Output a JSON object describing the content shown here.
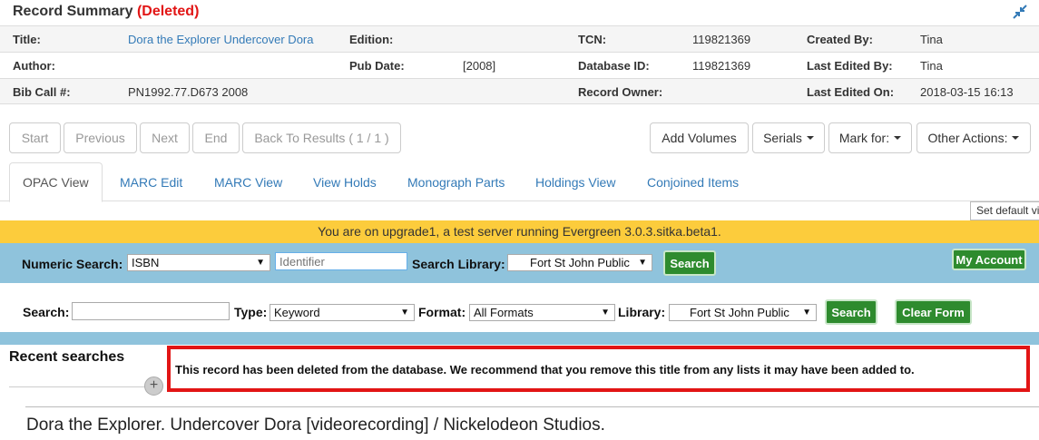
{
  "header": {
    "title": "Record Summary",
    "status": "(Deleted)"
  },
  "summary": {
    "title_label": "Title:",
    "title_value": "Dora the Explorer Undercover Dora",
    "edition_label": "Edition:",
    "edition_value": "",
    "tcn_label": "TCN:",
    "tcn_value": "119821369",
    "created_by_label": "Created By:",
    "created_by_value": "Tina",
    "author_label": "Author:",
    "author_value": "",
    "pub_date_label": "Pub Date:",
    "pub_date_value": "[2008]",
    "db_id_label": "Database ID:",
    "db_id_value": "119821369",
    "last_edited_by_label": "Last Edited By:",
    "last_edited_by_value": "Tina",
    "bib_call_label": "Bib Call #:",
    "bib_call_value": "PN1992.77.D673 2008",
    "owner_label": "Record Owner:",
    "owner_value": "",
    "last_edited_on_label": "Last Edited On:",
    "last_edited_on_value": "2018-03-15 16:13"
  },
  "nav": {
    "start": "Start",
    "previous": "Previous",
    "next": "Next",
    "end": "End",
    "back": "Back To Results ( 1 / 1 )"
  },
  "actions": {
    "add_volumes": "Add Volumes",
    "serials": "Serials",
    "mark_for": "Mark for:",
    "other": "Other Actions:"
  },
  "tabs": [
    "OPAC View",
    "MARC Edit",
    "MARC View",
    "View Holds",
    "Monograph Parts",
    "Holdings View",
    "Conjoined Items"
  ],
  "set_default": "Set default view",
  "banner": "You are on upgrade1, a test server running Evergreen 3.0.3.sitka.beta1.",
  "numeric_search": {
    "label": "Numeric Search:",
    "type_value": "ISBN",
    "placeholder": "Identifier",
    "library_label": "Search Library:",
    "library_value": "Fort St John Public",
    "search_button": "Search",
    "my_account": "My Account"
  },
  "basic_search": {
    "search_label": "Search:",
    "search_value": "",
    "type_label": "Type:",
    "type_value": "Keyword",
    "format_label": "Format:",
    "format_value": "All Formats",
    "library_label": "Library:",
    "library_value": "Fort St John Public",
    "search_button": "Search",
    "clear_button": "Clear Form"
  },
  "recent_searches": "Recent searches",
  "alert": "This record has been deleted from the database. We recommend that you remove this title from any lists it may have been added to.",
  "record_title": "Dora the Explorer. Undercover Dora [videorecording] / Nickelodeon Studios.",
  "colors": {
    "deleted": "#e21515",
    "link": "#337ab7",
    "banner": "#fccc3c",
    "search_bar": "#8fc3dc",
    "button_green": "#2e8b2e"
  }
}
